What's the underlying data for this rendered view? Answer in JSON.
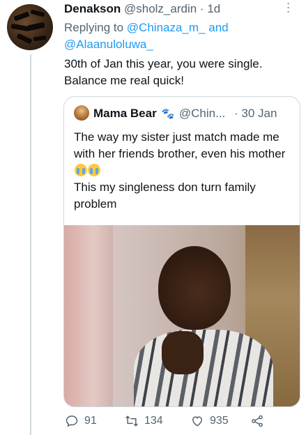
{
  "tweet": {
    "author_name": "Denakson",
    "author_handle": "@sholz_ardin",
    "separator": "·",
    "time": "1d",
    "replying_prefix": "Replying to",
    "reply_mention_1": "@Chinaza_m_",
    "reply_and": "and",
    "reply_mention_2": "@Alaanuloluwa_",
    "text_line_1": "30th of Jan this year, you were single.",
    "text_line_2": "Balance me real quick!"
  },
  "quote": {
    "author_name": "Mama Bear",
    "author_handle": "@Chin...",
    "separator": "·",
    "date": "30 Jan",
    "text_part_1": "The way my sister just match made me with her friends brother, even his mother",
    "text_part_2": "This my singleness don turn family problem"
  },
  "actions": {
    "reply_count": "91",
    "retweet_count": "134",
    "like_count": "935"
  },
  "colors": {
    "accent": "#1d9bf0",
    "muted": "#536471",
    "text": "#0f1419",
    "border": "#cfd9de"
  },
  "icons": [
    "more-icon",
    "paw-icon",
    "crying-face-emoji",
    "reply-icon",
    "retweet-icon",
    "like-icon",
    "share-icon"
  ]
}
